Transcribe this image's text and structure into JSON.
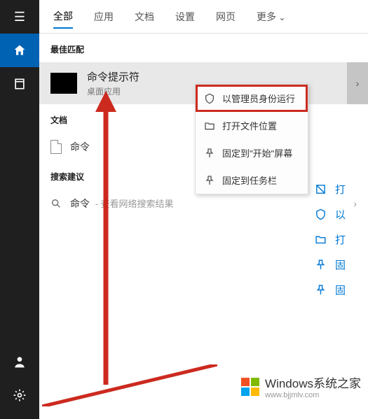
{
  "sidebar": {
    "items": [
      "menu",
      "home",
      "recent",
      "account",
      "settings"
    ]
  },
  "tabs": [
    {
      "label": "全部",
      "active": true
    },
    {
      "label": "应用"
    },
    {
      "label": "文档"
    },
    {
      "label": "设置"
    },
    {
      "label": "网页"
    },
    {
      "label": "更多",
      "more": true
    }
  ],
  "sections": {
    "best_match_header": "最佳匹配",
    "documents_header": "文档",
    "suggestions_header": "搜索建议"
  },
  "best_match": {
    "title": "命令提示符",
    "subtitle": "桌面应用"
  },
  "document": {
    "label": "命令"
  },
  "suggestion": {
    "term": "命令",
    "sub": " - 查看网络搜索结果"
  },
  "context_menu": [
    {
      "icon": "admin",
      "label": "以管理员身份运行",
      "highlight": true
    },
    {
      "icon": "folder",
      "label": "打开文件位置"
    },
    {
      "icon": "pin",
      "label": "固定到\"开始\"屏幕"
    },
    {
      "icon": "pin",
      "label": "固定到任务栏"
    }
  ],
  "right_list": [
    {
      "icon": "open",
      "label": "打"
    },
    {
      "icon": "admin",
      "label": "以"
    },
    {
      "icon": "folder",
      "label": "打"
    },
    {
      "icon": "pin",
      "label": "固"
    },
    {
      "icon": "pin",
      "label": "固"
    }
  ],
  "watermark": {
    "title": "Windows系统之家",
    "url": "www.bjjmlv.com"
  }
}
